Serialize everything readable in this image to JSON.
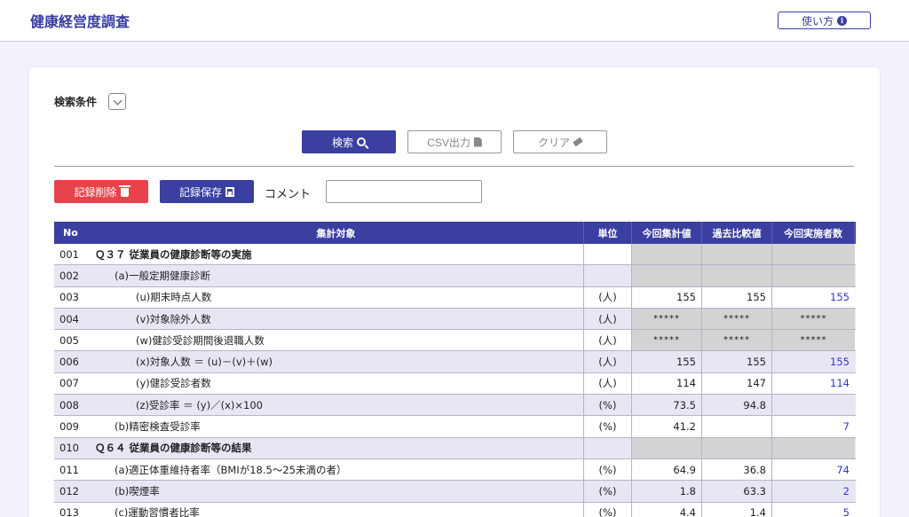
{
  "header": {
    "title": "健康経営度調査",
    "help_label": "使い方"
  },
  "search": {
    "condition_label": "検索条件",
    "search_label": "検索",
    "csv_label": "CSV出力",
    "clear_label": "クリア"
  },
  "record": {
    "delete_label": "記録削除",
    "save_label": "記録保存",
    "comment_label": "コメント",
    "comment_value": ""
  },
  "table": {
    "columns": {
      "no": "No",
      "target": "集計対象",
      "unit": "単位",
      "current": "今回集計値",
      "past": "過去比較値",
      "participants": "今回実施者数"
    },
    "rows": [
      {
        "no": "001",
        "target": "Ｑ３７ 従業員の健康診断等の実施",
        "unit": "",
        "current": "",
        "past": "",
        "participants": ""
      },
      {
        "no": "002",
        "target": "(a)一般定期健康診断",
        "unit": "",
        "current": "",
        "past": "",
        "participants": ""
      },
      {
        "no": "003",
        "target": "(u)期末時点人数",
        "unit": "(人)",
        "current": "155",
        "past": "155",
        "participants": "155"
      },
      {
        "no": "004",
        "target": "(v)対象除外人数",
        "unit": "(人)",
        "current": "*****",
        "past": "*****",
        "participants": "*****"
      },
      {
        "no": "005",
        "target": "(w)健診受診期間後退職人数",
        "unit": "(人)",
        "current": "*****",
        "past": "*****",
        "participants": "*****"
      },
      {
        "no": "006",
        "target": "(x)対象人数 ＝ (u)－(v)＋(w)",
        "unit": "(人)",
        "current": "155",
        "past": "155",
        "participants": "155"
      },
      {
        "no": "007",
        "target": "(y)健診受診者数",
        "unit": "(人)",
        "current": "114",
        "past": "147",
        "participants": "114"
      },
      {
        "no": "008",
        "target": "(z)受診率 ＝ (y)／(x)×100",
        "unit": "(%)",
        "current": "73.5",
        "past": "94.8",
        "participants": ""
      },
      {
        "no": "009",
        "target": "(b)精密検査受診率",
        "unit": "(%)",
        "current": "41.2",
        "past": "",
        "participants": "7"
      },
      {
        "no": "010",
        "target": "Ｑ６４ 従業員の健康診断等の結果",
        "unit": "",
        "current": "",
        "past": "",
        "participants": ""
      },
      {
        "no": "011",
        "target": "(a)適正体重維持者率（BMIが18.5～25未満の者）",
        "unit": "(%)",
        "current": "64.9",
        "past": "36.8",
        "participants": "74"
      },
      {
        "no": "012",
        "target": "(b)喫煙率",
        "unit": "(%)",
        "current": "1.8",
        "past": "63.3",
        "participants": "2"
      },
      {
        "no": "013",
        "target": "(c)運動習慣者比率",
        "unit": "(%)",
        "current": "4.4",
        "past": "1.4",
        "participants": "5"
      }
    ]
  }
}
